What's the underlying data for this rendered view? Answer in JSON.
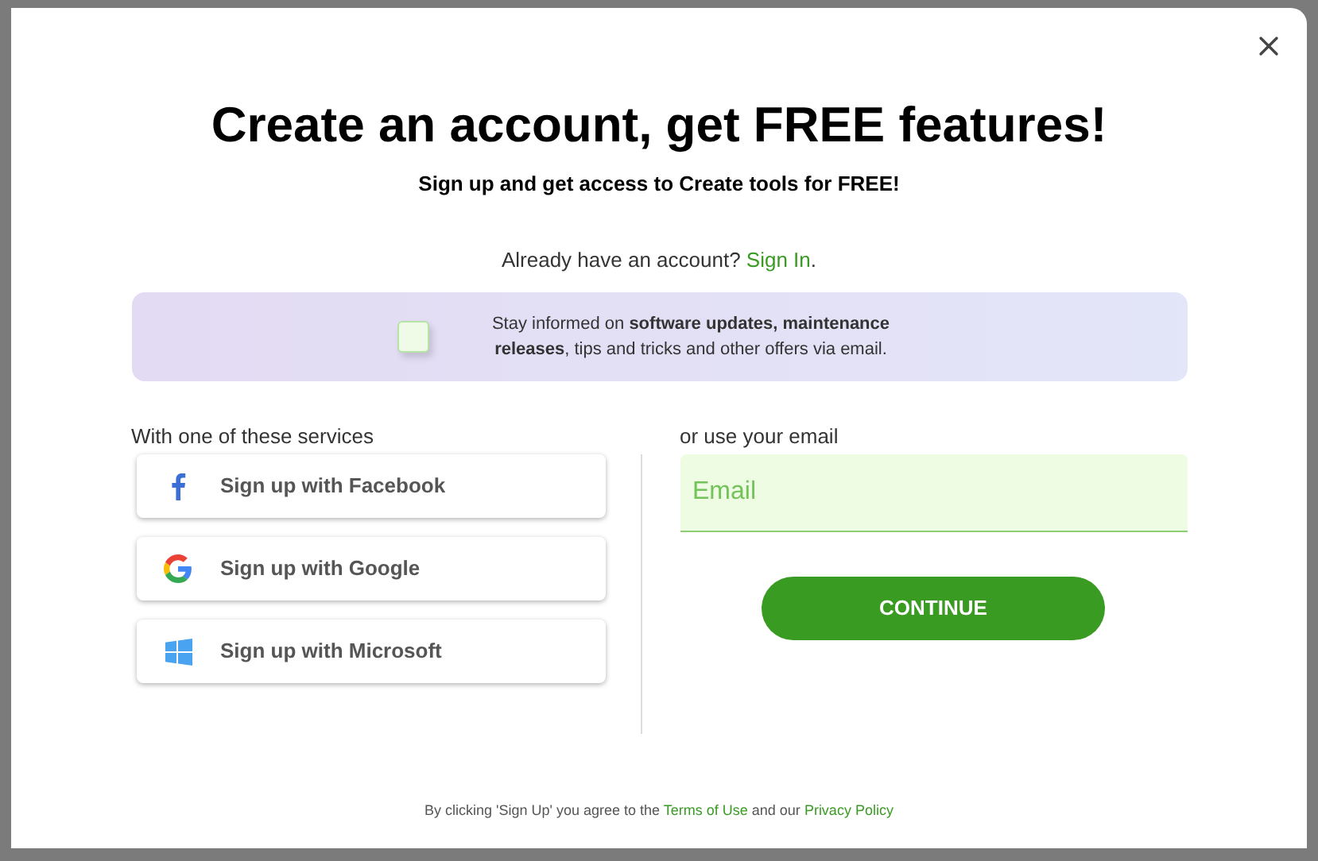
{
  "title": "Create an account, get FREE features!",
  "subtitle": "Sign up and get access to Create tools for FREE!",
  "signin": {
    "prefix": "Already have an account? ",
    "link": "Sign In",
    "suffix": "."
  },
  "newsletter": {
    "checked": false,
    "text": "Stay informed on **software updates, maintenance releases**, tips and tricks and other offers via email."
  },
  "services": {
    "heading": "With one of these services",
    "buttons": [
      {
        "kind": "facebook",
        "label": "Sign up with Facebook"
      },
      {
        "kind": "google",
        "label": "Sign up with Google"
      },
      {
        "kind": "microsoft",
        "label": "Sign up with Microsoft"
      }
    ]
  },
  "email": {
    "heading": "or use your email",
    "placeholder": "Email",
    "button": "CONTINUE"
  },
  "footer": {
    "prefix": "By clicking 'Sign Up' you agree to the ",
    "terms": "Terms of Use",
    "middle": " and our ",
    "privacy": "Privacy Policy"
  }
}
